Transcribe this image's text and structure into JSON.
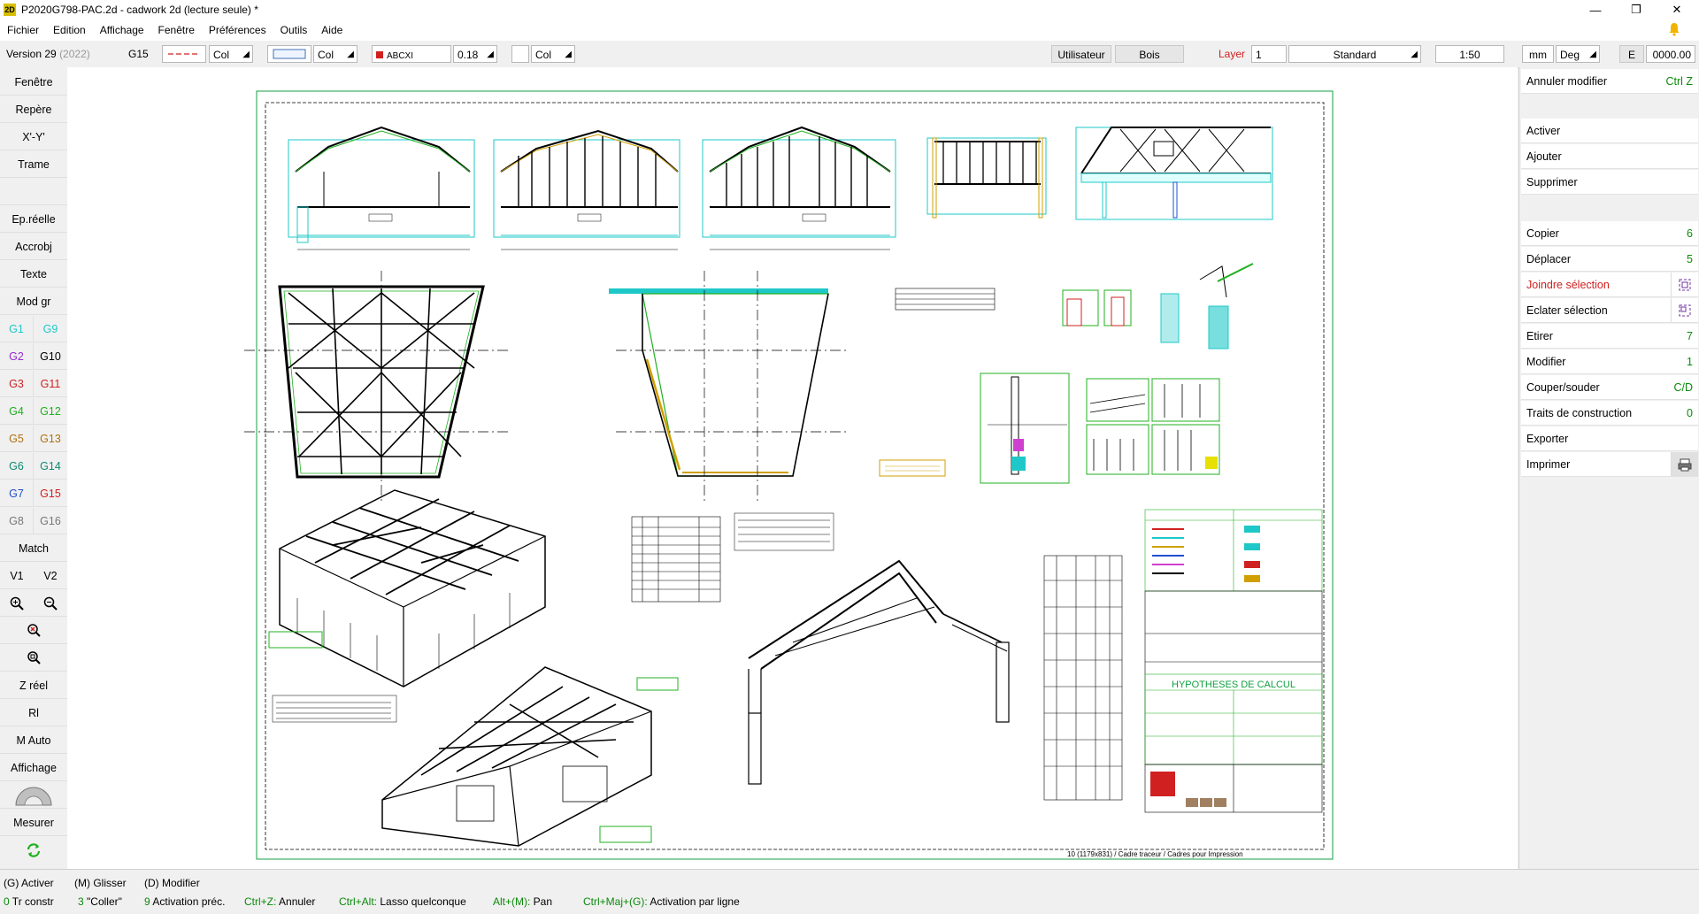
{
  "window": {
    "app_icon_text": "2D",
    "title": "P2020G798-PAC.2d - cadwork 2d (lecture seule) *",
    "minimize": "—",
    "restore": "❐",
    "close": "✕"
  },
  "menu": [
    "Fichier",
    "Edition",
    "Affichage",
    "Fenêtre",
    "Préférences",
    "Outils",
    "Aide"
  ],
  "toolbar": {
    "version": "Version 29",
    "version_year": "(2022)",
    "group": "G15",
    "col1": "Col",
    "col2": "Col",
    "text_style": "ABCXI",
    "line_width": "0.18",
    "col3": "Col",
    "user": "Utilisateur",
    "material": "Bois",
    "layer_label": "Layer",
    "layer_value": "1",
    "style": "Standard",
    "scale": "1:50",
    "unit": "mm",
    "angle_unit": "Deg",
    "e_label": "E",
    "e_value": "0000.00"
  },
  "left_panel": {
    "buttons_top": [
      "Fenêtre",
      "Repère",
      "X'-Y'",
      "Trame"
    ],
    "buttons_mid": [
      "Ep.réelle",
      "Accrobj",
      "Texte",
      "Mod gr"
    ],
    "groups_left": [
      {
        "label": "G1",
        "color": "#1ec8c8"
      },
      {
        "label": "G2",
        "color": "#9a2ad0"
      },
      {
        "label": "G3",
        "color": "#d02020"
      },
      {
        "label": "G4",
        "color": "#20b020"
      },
      {
        "label": "G5",
        "color": "#b07010"
      },
      {
        "label": "G6",
        "color": "#108a70"
      },
      {
        "label": "G7",
        "color": "#2050d0"
      },
      {
        "label": "G8",
        "color": "#777777"
      }
    ],
    "groups_right": [
      {
        "label": "G9",
        "color": "#1ec8c8"
      },
      {
        "label": "G10",
        "color": "#000000"
      },
      {
        "label": "G11",
        "color": "#d02020"
      },
      {
        "label": "G12",
        "color": "#20b020"
      },
      {
        "label": "G13",
        "color": "#b07010"
      },
      {
        "label": "G14",
        "color": "#108a70"
      },
      {
        "label": "G15",
        "color": "#d02020"
      },
      {
        "label": "G16",
        "color": "#777777"
      }
    ],
    "match": "Match",
    "v1": "V1",
    "v2": "V2",
    "z_reel": "Z réel",
    "rl": "Rl",
    "m_auto": "M Auto",
    "affichage": "Affichage",
    "mesurer": "Mesurer"
  },
  "right_panel": {
    "undo": {
      "label": "Annuler modifier",
      "key": "Ctrl Z"
    },
    "group1": [
      {
        "label": "Activer",
        "key": ""
      },
      {
        "label": "Ajouter",
        "key": ""
      },
      {
        "label": "Supprimer",
        "key": ""
      }
    ],
    "group2": [
      {
        "label": "Copier",
        "key": "6"
      },
      {
        "label": "Déplacer",
        "key": "5"
      },
      {
        "label": "Joindre sélection",
        "key": "",
        "color": "#d02020"
      },
      {
        "label": "Eclater sélection",
        "key": ""
      },
      {
        "label": "Etirer",
        "key": "7"
      },
      {
        "label": "Modifier",
        "key": "1"
      },
      {
        "label": "Couper/souder",
        "key": "C/D"
      },
      {
        "label": "Traits de construction",
        "key": "0"
      },
      {
        "label": "Exporter",
        "key": ""
      },
      {
        "label": "Imprimer",
        "key": ""
      }
    ]
  },
  "drawing": {
    "sheet_caption": "10 (1179x831) / Cadre traceur / Cadres pour Impression",
    "calc_title": "HYPOTHESES DE CALCUL"
  },
  "status": {
    "row1": [
      {
        "key": "(G)",
        "text": " Activer"
      },
      {
        "key": "(M)",
        "text": " Glisser"
      },
      {
        "key": "(D)",
        "text": " Modifier"
      }
    ],
    "row2": [
      {
        "key": "0",
        "text": " Tr constr"
      },
      {
        "key": "3",
        "text": " \"Coller\""
      },
      {
        "key": "9",
        "text": " Activation préc."
      },
      {
        "key": "Ctrl+Z:",
        "text": " Annuler"
      },
      {
        "key": "Ctrl+Alt:",
        "text": " Lasso quelconque"
      },
      {
        "key": "Alt+(M):",
        "text": " Pan"
      },
      {
        "key": "Ctrl+Maj+(G):",
        "text": " Activation par ligne"
      }
    ]
  }
}
